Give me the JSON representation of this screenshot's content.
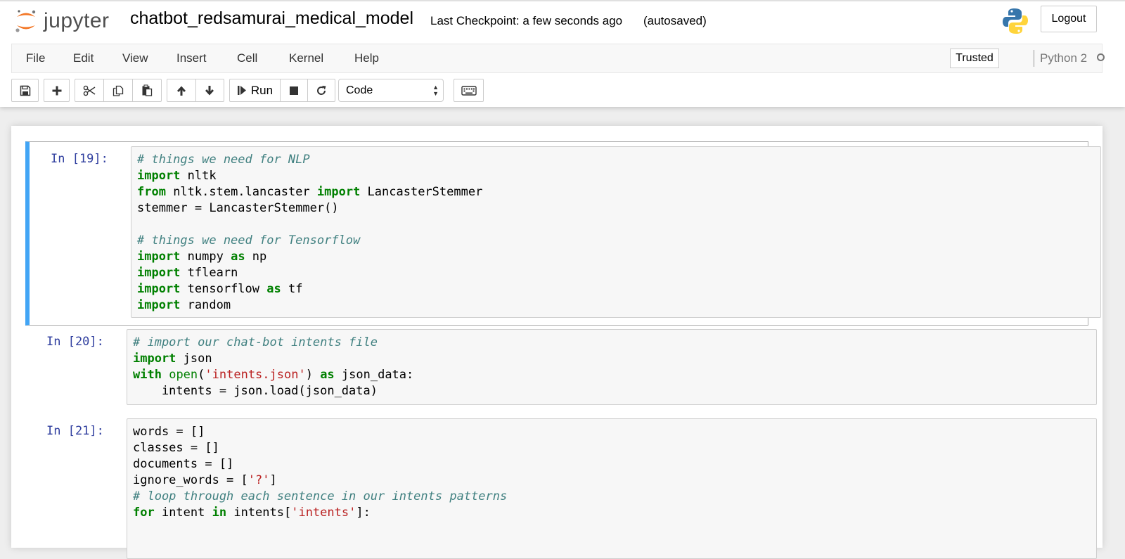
{
  "header": {
    "logo_text": "jupyter",
    "notebook_name": "chatbot_redsamurai_medical_model",
    "checkpoint": "Last Checkpoint: a few seconds ago",
    "autosave": "(autosaved)",
    "logout_label": "Logout"
  },
  "menubar": {
    "items": [
      "File",
      "Edit",
      "View",
      "Insert",
      "Cell",
      "Kernel",
      "Help"
    ],
    "trusted_label": "Trusted",
    "kernel_name": "Python 2"
  },
  "toolbar": {
    "run_label": "Run",
    "cell_type": "Code"
  },
  "cells": [
    {
      "prompt": "In [19]:",
      "lines": [
        [
          {
            "t": "cm",
            "s": "# things we need for NLP"
          }
        ],
        [
          {
            "t": "kw",
            "s": "import"
          },
          {
            "t": "",
            "s": " nltk"
          }
        ],
        [
          {
            "t": "kw",
            "s": "from"
          },
          {
            "t": "",
            "s": " nltk.stem.lancaster "
          },
          {
            "t": "kw",
            "s": "import"
          },
          {
            "t": "",
            "s": " LancasterStemmer"
          }
        ],
        [
          {
            "t": "",
            "s": "stemmer = LancasterStemmer()"
          }
        ],
        [
          {
            "t": "",
            "s": ""
          }
        ],
        [
          {
            "t": "cm",
            "s": "# things we need for Tensorflow"
          }
        ],
        [
          {
            "t": "kw",
            "s": "import"
          },
          {
            "t": "",
            "s": " numpy "
          },
          {
            "t": "kw",
            "s": "as"
          },
          {
            "t": "",
            "s": " np"
          }
        ],
        [
          {
            "t": "kw",
            "s": "import"
          },
          {
            "t": "",
            "s": " tflearn"
          }
        ],
        [
          {
            "t": "kw",
            "s": "import"
          },
          {
            "t": "",
            "s": " tensorflow "
          },
          {
            "t": "kw",
            "s": "as"
          },
          {
            "t": "",
            "s": " tf"
          }
        ],
        [
          {
            "t": "kw",
            "s": "import"
          },
          {
            "t": "",
            "s": " random"
          }
        ]
      ]
    },
    {
      "prompt": "In [20]:",
      "lines": [
        [
          {
            "t": "cm",
            "s": "# import our chat-bot intents file"
          }
        ],
        [
          {
            "t": "kw",
            "s": "import"
          },
          {
            "t": "",
            "s": " json"
          }
        ],
        [
          {
            "t": "kw",
            "s": "with"
          },
          {
            "t": "",
            "s": " "
          },
          {
            "t": "bi",
            "s": "open"
          },
          {
            "t": "",
            "s": "("
          },
          {
            "t": "st",
            "s": "'intents.json'"
          },
          {
            "t": "",
            "s": ") "
          },
          {
            "t": "kw",
            "s": "as"
          },
          {
            "t": "",
            "s": " json_data:"
          }
        ],
        [
          {
            "t": "",
            "s": "    intents = json.load(json_data)"
          }
        ]
      ]
    },
    {
      "prompt": "In [21]:",
      "lines": [
        [
          {
            "t": "",
            "s": "words = []"
          }
        ],
        [
          {
            "t": "",
            "s": "classes = []"
          }
        ],
        [
          {
            "t": "",
            "s": "documents = []"
          }
        ],
        [
          {
            "t": "",
            "s": "ignore_words = ["
          },
          {
            "t": "st",
            "s": "'?'"
          },
          {
            "t": "",
            "s": "]"
          }
        ],
        [
          {
            "t": "cm",
            "s": "# loop through each sentence in our intents patterns"
          }
        ],
        [
          {
            "t": "kw",
            "s": "for"
          },
          {
            "t": "",
            "s": " intent "
          },
          {
            "t": "kw",
            "s": "in"
          },
          {
            "t": "",
            "s": " intents["
          },
          {
            "t": "st",
            "s": "'intents'"
          },
          {
            "t": "",
            "s": "]:"
          }
        ]
      ]
    }
  ],
  "icons": {
    "save": "floppy-disk-icon",
    "add": "plus-icon",
    "cut": "scissors-icon",
    "copy": "copy-icon",
    "paste": "paste-icon",
    "move_up": "arrow-up-icon",
    "move_down": "arrow-down-icon",
    "run": "step-forward-icon",
    "interrupt": "stop-icon",
    "restart": "refresh-icon",
    "keyboard": "keyboard-icon"
  },
  "colors": {
    "selected_cell_bar": "#42a5f5",
    "prompt": "#303f9f",
    "comment": "#408080",
    "keyword": "#008000",
    "string": "#ba2121",
    "jupyter_orange": "#f37726"
  }
}
